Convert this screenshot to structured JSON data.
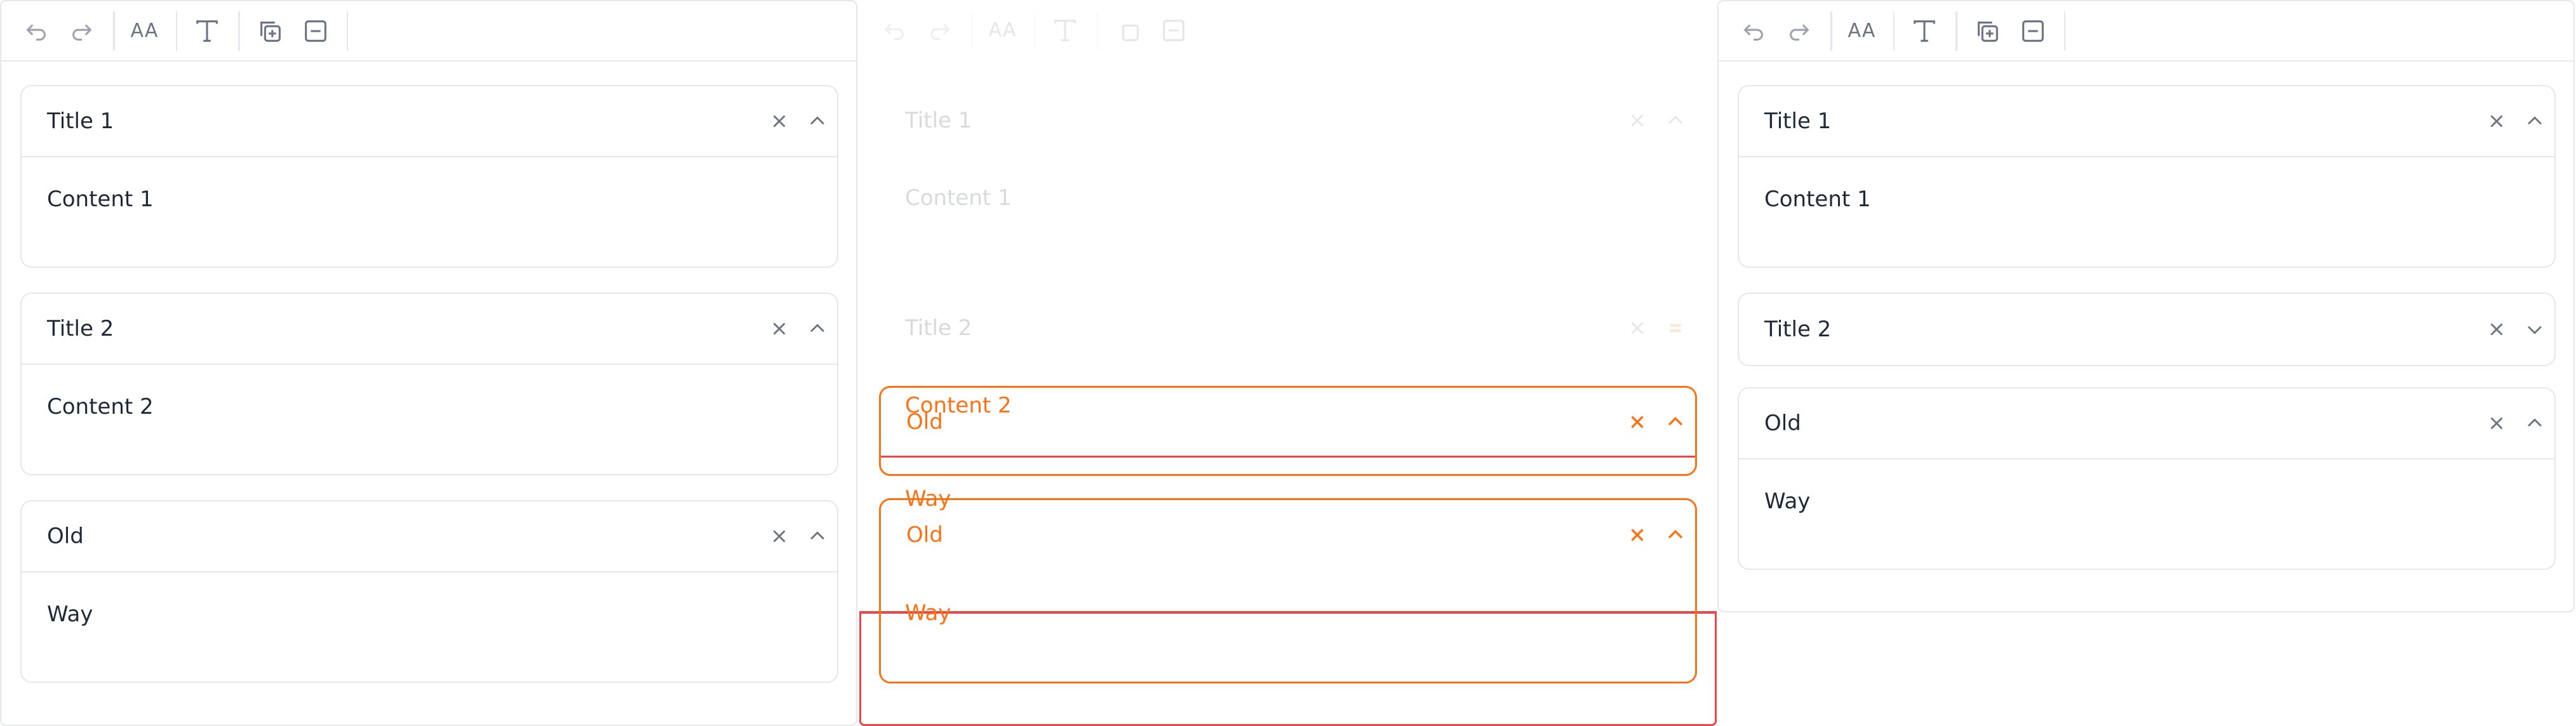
{
  "panels": [
    {
      "items": [
        {
          "title": "Title 1",
          "content": "Content 1"
        },
        {
          "title": "Title 2",
          "content": "Content 2"
        },
        {
          "title": "Old",
          "content": "Way"
        }
      ]
    },
    {
      "ghost_items": [
        {
          "title": "Title 1",
          "content": "Content 1"
        },
        {
          "title": "Title 2",
          "content": "Content 2"
        }
      ],
      "drag_items": [
        {
          "title": "Old",
          "content": "Way"
        },
        {
          "title": "Old",
          "content": "Way"
        }
      ],
      "overlay_text": "Content 2"
    },
    {
      "items": [
        {
          "title": "Title 1",
          "content": "Content 1",
          "expanded": true
        },
        {
          "title": "Title 2",
          "expanded": false
        },
        {
          "title": "Old",
          "content": "Way",
          "expanded": true
        }
      ]
    }
  ],
  "toolbar": {
    "font_size_label": "AA"
  },
  "colors": {
    "border": "#e5e7eb",
    "icon": "#6b7280",
    "drag_orange": "#f97316",
    "drag_red": "#ef4444"
  }
}
